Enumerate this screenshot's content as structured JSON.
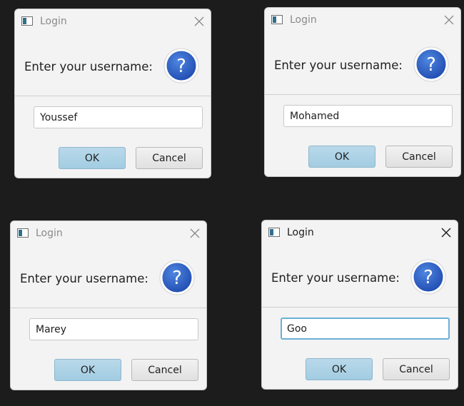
{
  "dialogs": [
    {
      "title": "Login",
      "prompt": "Enter your username:",
      "username_value": "Youssef",
      "ok_label": "OK",
      "cancel_label": "Cancel"
    },
    {
      "title": "Login",
      "prompt": "Enter your username:",
      "username_value": "Mohamed",
      "ok_label": "OK",
      "cancel_label": "Cancel"
    },
    {
      "title": "Login",
      "prompt": "Enter your username:",
      "username_value": "Marey",
      "ok_label": "OK",
      "cancel_label": "Cancel"
    },
    {
      "title": "Login",
      "prompt": "Enter your username:",
      "username_value": "Goo",
      "ok_label": "OK",
      "cancel_label": "Cancel"
    }
  ],
  "icons": {
    "window": "window-icon",
    "close": "close-icon",
    "dialog": "question-mark-icon"
  },
  "colors": {
    "background": "#1c1c1c",
    "dialog_bg": "#f3f3f3",
    "ok_button": "#a9d0e6",
    "question_icon": "#2f63c8",
    "focus_border": "#6ab0d6"
  }
}
